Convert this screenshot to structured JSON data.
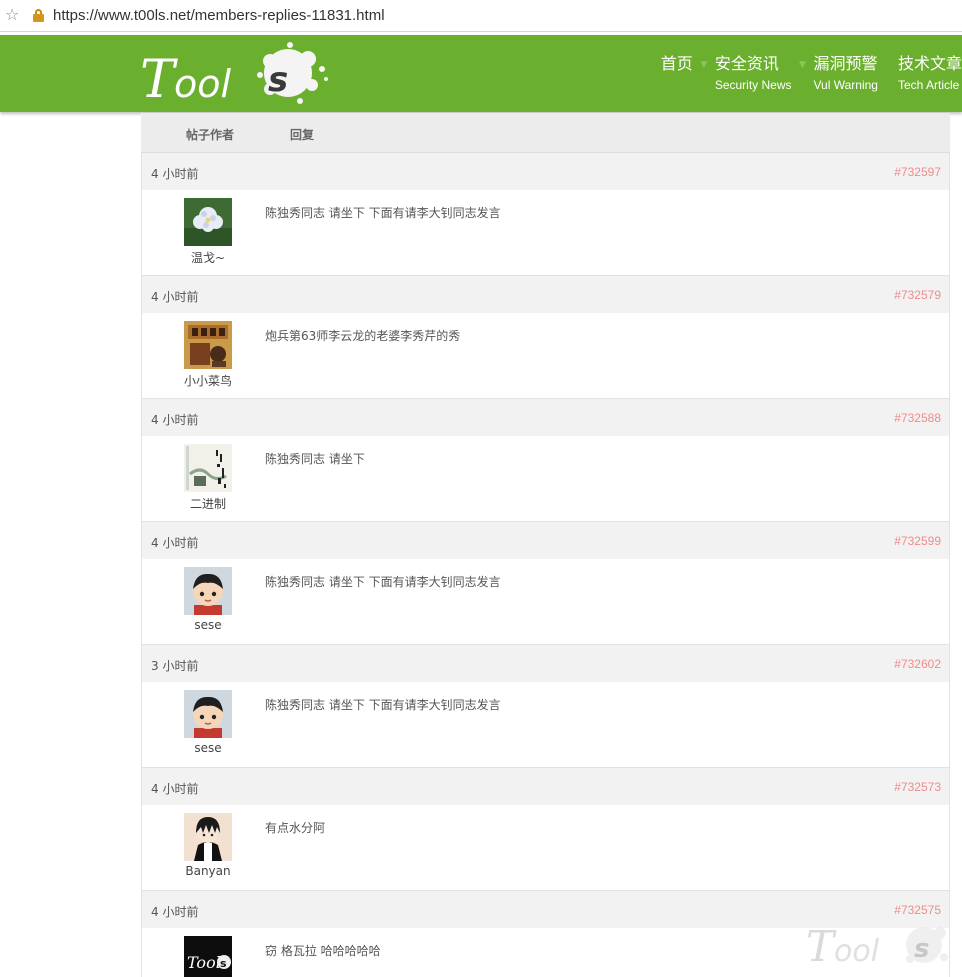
{
  "browser": {
    "url": "https://www.t00ls.net/members-replies-11831.html",
    "star_icon": "star-icon",
    "lock_icon": "lock-icon"
  },
  "site": {
    "logo_text": "T00lS",
    "brand_color": "#6aaf2e",
    "nav": [
      {
        "zh": "首页",
        "en": ""
      },
      {
        "zh": "安全资讯",
        "en": "Security News"
      },
      {
        "zh": "漏洞预警",
        "en": "Vul Warning"
      },
      {
        "zh": "技术文章",
        "en": "Tech Article"
      }
    ]
  },
  "table": {
    "col_author": "帖子作者",
    "col_reply": "回复"
  },
  "posts": [
    {
      "time": "4 小时前",
      "id": "#732597",
      "user": "温戈~",
      "message": "陈独秀同志 请坐下 下面有请李大钊同志发言",
      "avatar": "flower-avatar"
    },
    {
      "time": "4 小时前",
      "id": "#732579",
      "user": "小小菜鸟",
      "message": "炮兵第63师李云龙的老婆李秀芹的秀",
      "avatar": "book-cover-avatar"
    },
    {
      "time": "4 小时前",
      "id": "#732588",
      "user": "二进制",
      "message": "陈独秀同志 请坐下",
      "avatar": "ink-painting-avatar"
    },
    {
      "time": "4 小时前",
      "id": "#732599",
      "user": "sese",
      "message": "陈独秀同志 请坐下 下面有请李大钊同志发言",
      "avatar": "cartoon-kid-avatar"
    },
    {
      "time": "3 小时前",
      "id": "#732602",
      "user": "sese",
      "message": "陈独秀同志 请坐下 下面有请李大钊同志发言",
      "avatar": "cartoon-kid-avatar"
    },
    {
      "time": "4 小时前",
      "id": "#732573",
      "user": "Banyan",
      "message": "有点水分阿",
      "avatar": "anime-boy-avatar"
    },
    {
      "time": "4 小时前",
      "id": "#732575",
      "user": "",
      "message": "窃 格瓦拉 哈哈哈哈哈",
      "avatar": "t00ls-logo-avatar"
    }
  ]
}
